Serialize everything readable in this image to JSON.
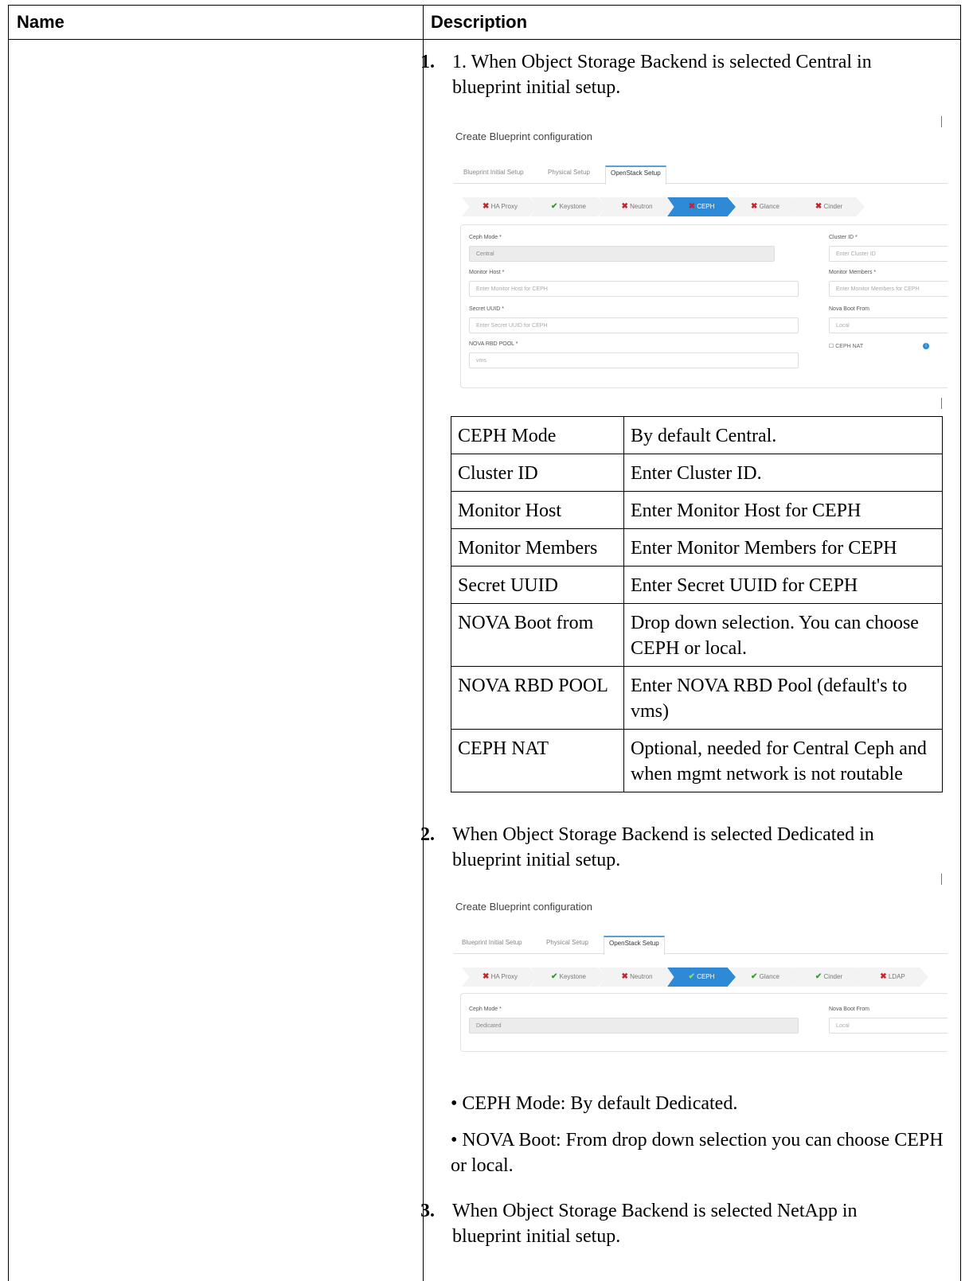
{
  "header": {
    "name": "Name",
    "description": "Description"
  },
  "step1": {
    "number": "1.",
    "text": "1. When Object Storage Backend is selected Central in blueprint initial setup."
  },
  "shot1": {
    "title": "Create Blueprint configuration",
    "tabs": [
      "Blueprint Initial Setup",
      "Physical Setup",
      "OpenStack Setup"
    ],
    "steps": [
      {
        "label": "HA Proxy",
        "status": "error"
      },
      {
        "label": "Keystone",
        "status": "ok"
      },
      {
        "label": "Neutron",
        "status": "error"
      },
      {
        "label": "CEPH",
        "status": "error",
        "active": true
      },
      {
        "label": "Glance",
        "status": "error"
      },
      {
        "label": "Cinder",
        "status": "error"
      }
    ],
    "fields": {
      "ceph_mode_label": "Ceph Mode *",
      "ceph_mode_value": "Central",
      "monitor_host_label": "Monitor Host *",
      "monitor_host_placeholder": "Enter Monitor Host for CEPH",
      "secret_uuid_label": "Secret UUID *",
      "secret_uuid_placeholder": "Enter Secret UUID for CEPH",
      "nova_rbd_label": "NOVA RBD POOL *",
      "nova_rbd_value": "vms",
      "cluster_id_label": "Cluster ID *",
      "cluster_id_placeholder": "Enter Cluster ID",
      "monitor_members_label": "Monitor Members *",
      "monitor_members_placeholder": "Enter Monitor Members for CEPH",
      "nova_boot_label": "Nova Boot From",
      "nova_boot_value": "Local",
      "ceph_nat_label": "CEPH NAT"
    }
  },
  "params": [
    {
      "name": "CEPH Mode",
      "desc": "By default Central."
    },
    {
      "name": "Cluster ID",
      "desc": "Enter Cluster ID."
    },
    {
      "name": "Monitor Host",
      "desc": "Enter Monitor Host for CEPH"
    },
    {
      "name": "Monitor Members",
      "desc": "Enter Monitor Members for CEPH"
    },
    {
      "name": "Secret UUID",
      "desc": "Enter Secret UUID for CEPH"
    },
    {
      "name": "NOVA Boot from",
      "desc": "Drop down selection. You can choose CEPH or local."
    },
    {
      "name": "NOVA RBD POOL",
      "desc": "Enter NOVA RBD Pool (default's to vms)"
    },
    {
      "name": "CEPH NAT",
      "desc": "Optional, needed for Central Ceph and when mgmt network is not routable"
    }
  ],
  "step2": {
    "number": "2.",
    "text": "When Object Storage Backend is selected Dedicated in blueprint initial setup."
  },
  "shot2": {
    "title": "Create Blueprint configuration",
    "tabs": [
      "Blueprint Initial Setup",
      "Physical Setup",
      "OpenStack Setup"
    ],
    "steps": [
      {
        "label": "HA Proxy",
        "status": "error"
      },
      {
        "label": "Keystone",
        "status": "ok"
      },
      {
        "label": "Neutron",
        "status": "error"
      },
      {
        "label": "CEPH",
        "status": "ok",
        "active": true
      },
      {
        "label": "Glance",
        "status": "ok"
      },
      {
        "label": "Cinder",
        "status": "ok"
      },
      {
        "label": "LDAP",
        "status": "error"
      }
    ],
    "fields": {
      "ceph_mode_label": "Ceph Mode *",
      "ceph_mode_value": "Dedicated",
      "nova_boot_label": "Nova Boot From",
      "nova_boot_value": "Local"
    }
  },
  "bullets": [
    "• CEPH Mode: By default Dedicated.",
    "• NOVA Boot: From drop down selection you can choose CEPH or local."
  ],
  "step3": {
    "number": "3.",
    "text": "When Object Storage Backend is selected NetApp in blueprint initial setup."
  }
}
